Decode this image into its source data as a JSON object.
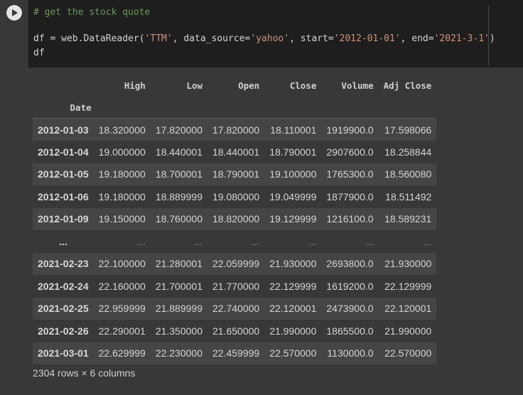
{
  "cell": {
    "code_lines": [
      [
        {
          "cls": "tok-comment",
          "text": "# get the stock quote"
        }
      ],
      [],
      [
        {
          "cls": "tok-plain",
          "text": "df = web.DataReader("
        },
        {
          "cls": "tok-string",
          "text": "'TTM'"
        },
        {
          "cls": "tok-plain",
          "text": ", data_source="
        },
        {
          "cls": "tok-string",
          "text": "'yahoo'"
        },
        {
          "cls": "tok-plain",
          "text": ", start="
        },
        {
          "cls": "tok-string",
          "text": "'2012-01-01'"
        },
        {
          "cls": "tok-plain",
          "text": ", end="
        },
        {
          "cls": "tok-string",
          "text": "'2021-3-1'"
        },
        {
          "cls": "tok-plain",
          "text": ")"
        }
      ],
      [
        {
          "cls": "tok-plain",
          "text": "df"
        }
      ]
    ]
  },
  "output": {
    "columns": [
      "High",
      "Low",
      "Open",
      "Close",
      "Volume",
      "Adj Close"
    ],
    "index_name": "Date",
    "rows": [
      {
        "index": "2012-01-03",
        "values": [
          "18.320000",
          "17.820000",
          "17.820000",
          "18.110001",
          "1919900.0",
          "17.598066"
        ]
      },
      {
        "index": "2012-01-04",
        "values": [
          "19.000000",
          "18.440001",
          "18.440001",
          "18.790001",
          "2907600.0",
          "18.258844"
        ]
      },
      {
        "index": "2012-01-05",
        "values": [
          "19.180000",
          "18.700001",
          "18.790001",
          "19.100000",
          "1765300.0",
          "18.560080"
        ]
      },
      {
        "index": "2012-01-06",
        "values": [
          "19.180000",
          "18.889999",
          "19.080000",
          "19.049999",
          "1877900.0",
          "18.511492"
        ]
      },
      {
        "index": "2012-01-09",
        "values": [
          "19.150000",
          "18.760000",
          "18.820000",
          "19.129999",
          "1216100.0",
          "18.589231"
        ]
      },
      {
        "index": "...",
        "values": [
          "...",
          "...",
          "...",
          "...",
          "...",
          "..."
        ],
        "ellipsis": true
      },
      {
        "index": "2021-02-23",
        "values": [
          "22.100000",
          "21.280001",
          "22.059999",
          "21.930000",
          "2693800.0",
          "21.930000"
        ]
      },
      {
        "index": "2021-02-24",
        "values": [
          "22.160000",
          "21.700001",
          "21.770000",
          "22.129999",
          "1619200.0",
          "22.129999"
        ]
      },
      {
        "index": "2021-02-25",
        "values": [
          "22.959999",
          "21.889999",
          "22.740000",
          "22.120001",
          "2473900.0",
          "22.120001"
        ]
      },
      {
        "index": "2021-02-26",
        "values": [
          "22.290001",
          "21.350000",
          "21.650000",
          "21.990000",
          "1865500.0",
          "21.990000"
        ]
      },
      {
        "index": "2021-03-01",
        "values": [
          "22.629999",
          "22.230000",
          "22.459999",
          "22.570000",
          "1130000.0",
          "22.570000"
        ]
      }
    ],
    "shape_text": "2304 rows × 6 columns"
  }
}
